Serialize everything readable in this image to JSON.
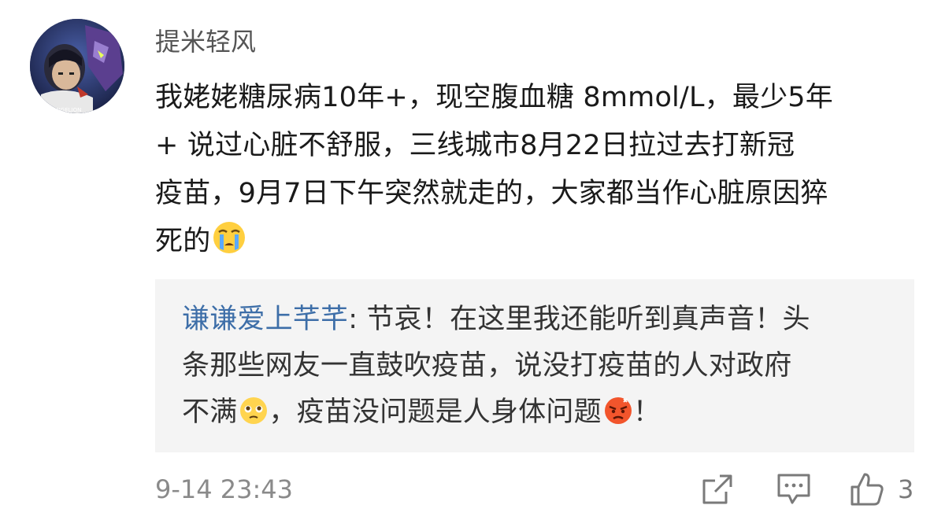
{
  "comment": {
    "username": "提米轻风",
    "body_lines": [
      "我姥姥糖尿病10年+，现空腹血糖 8mmol/L，最少5年",
      "+ 说过心脏不舒服，三线城市8月22日拉过去打新冠",
      "疫苗，9月7日下午突然就走的，大家都当作心脏原因猝",
      "死的"
    ],
    "body_emoji": "crying-emoji",
    "avatar_caption": "EVANGELION",
    "timestamp": "9-14 23:43",
    "like_count": "3"
  },
  "reply": {
    "author": "谦谦爱上芊芊",
    "line1_text": ": 节哀！在这里我还能听到真声音！头",
    "line2_text": "条那些网友一直鼓吹疫苗，说没打疫苗的人对政府",
    "line3_before": "不满",
    "line3_middle": "，疫苗没问题是人身体问题",
    "line3_after": "！",
    "emoji_1": "pleading-emoji",
    "emoji_2": "angry-emoji"
  },
  "colors": {
    "author_link": "#3d6ea8",
    "reply_bg": "#f4f4f4",
    "body_text": "#1a1a1a",
    "meta_text": "#8a8a8a"
  }
}
